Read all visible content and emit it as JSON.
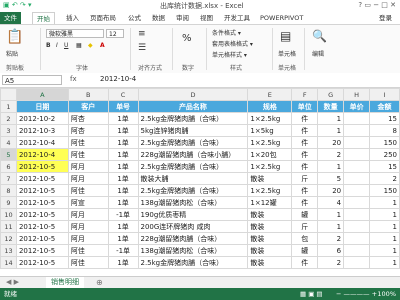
{
  "window": {
    "title": "出库统计数据.xlsx - Excel",
    "controls": "? ▭ − □ ✕"
  },
  "ribbon_tabs": [
    "文件",
    "开始",
    "插入",
    "页面布局",
    "公式",
    "数据",
    "审阅",
    "视图",
    "开发工具",
    "POWERPIVOT"
  ],
  "login": "登录",
  "ribbon": {
    "paste": "粘贴",
    "font_name": "微软雅黑",
    "font_size": "12",
    "align_label": "对齐方式",
    "number_label": "数字",
    "percent": "%",
    "cond_format": "条件格式 ▾",
    "table_format": "套用表格格式 ▾",
    "cell_style": "单元格样式 ▾",
    "cells_btn": "单元格",
    "edit_btn": "编辑",
    "groups": {
      "clipboard": "剪贴板",
      "font": "字体",
      "align": "对齐方式",
      "number": "数字",
      "styles": "样式",
      "cells": "单元格"
    }
  },
  "formula_bar": {
    "name_box": "A5",
    "fx": "fx",
    "value": "2012-10-4"
  },
  "columns": [
    "A",
    "B",
    "C",
    "D",
    "E",
    "F",
    "G",
    "H",
    "I"
  ],
  "headers": [
    "日期",
    "客户",
    "单号",
    "产品名称",
    "规格",
    "单位",
    "数量",
    "单价",
    "金额"
  ],
  "rows": [
    [
      "2012-10-2",
      "阿杏",
      "1单",
      "2.5kg金牌猪肉脯（合味）",
      "1×2.5kg",
      "件",
      "1",
      "",
      "15"
    ],
    [
      "2012-10-3",
      "阿杏",
      "1单",
      "5kg连锌猪肉脯",
      "1×5kg",
      "件",
      "1",
      "",
      "8"
    ],
    [
      "2012-10-4",
      "阿佳",
      "1单",
      "2.5kg金牌猪肉脯（合味）",
      "1×2.5kg",
      "件",
      "20",
      "",
      "150"
    ],
    [
      "2012-10-4",
      "阿佳",
      "1单",
      "228g潮留猪肉脯（合味小脯）",
      "1×20包",
      "件",
      "2",
      "",
      "250"
    ],
    [
      "2012-10-5",
      "阿月",
      "1单",
      "2.5kg金牌猪肉脯（合味）",
      "1×2.5kg",
      "件",
      "1",
      "",
      "15"
    ],
    [
      "2012-10-5",
      "阿月",
      "1单",
      "散装大脯",
      "散装",
      "斤",
      "5",
      "",
      "2"
    ],
    [
      "2012-10-5",
      "阿佳",
      "1单",
      "2.5kg金牌猪肉脯（合味）",
      "1×2.5kg",
      "件",
      "20",
      "",
      "150"
    ],
    [
      "2012-10-5",
      "阿宣",
      "1单",
      "138g潮留猪肉松（合味）",
      "1×12罐",
      "件",
      "4",
      "",
      "1"
    ],
    [
      "2012-10-5",
      "阿月",
      "-1单",
      "190g优质枣精",
      "散装",
      "罐",
      "1",
      "",
      "1"
    ],
    [
      "2012-10-5",
      "阿月",
      "1单",
      "200G连环牌猪肉 咸肉",
      "散装",
      "斤",
      "1",
      "",
      "1"
    ],
    [
      "2012-10-5",
      "阿月",
      "1单",
      "228g潮留猪肉脯（合味）",
      "散装",
      "包",
      "2",
      "",
      "1"
    ],
    [
      "2012-10-5",
      "阿佳",
      "-1单",
      "138g潮留猪肉松（合味）",
      "散装",
      "罐",
      "6",
      "",
      "1"
    ],
    [
      "2012-10-5",
      "阿佳",
      "1单",
      "2.5kg金牌猪肉脯（合味）",
      "散装",
      "件",
      "2",
      "",
      "1"
    ]
  ],
  "highlighted_cells": [
    "A5",
    "A6"
  ],
  "sheet_tab": "销售明细",
  "add_sheet": "⊕",
  "status": {
    "left": "就绪",
    "zoom": "100%"
  }
}
